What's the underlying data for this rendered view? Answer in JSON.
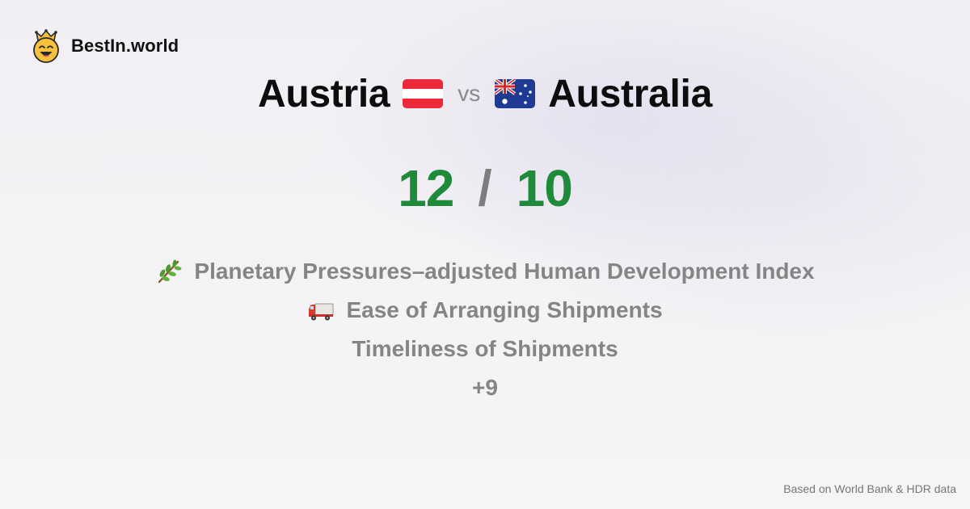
{
  "brand": {
    "name": "BestIn.world",
    "logo_icon": "crowned-smiley-icon"
  },
  "comparison": {
    "left": {
      "name": "Austria",
      "flag_icon": "austria-flag-icon",
      "score": "12"
    },
    "vs_label": "vs",
    "right": {
      "name": "Australia",
      "flag_icon": "australia-flag-icon",
      "score": "10"
    },
    "score_separator": "/"
  },
  "metrics": [
    {
      "label": "Planetary Pressures–adjusted Human Development Index",
      "icon": "herb-icon"
    },
    {
      "label": "Ease of Arranging Shipments",
      "icon": "delivery-truck-icon"
    },
    {
      "label": "Timeliness of Shipments",
      "icon": ""
    }
  ],
  "more_label": "+9",
  "footer": {
    "source": "Based on World Bank & HDR data"
  },
  "colors": {
    "score_green": "#1f8a3a",
    "muted_gray": "#858585",
    "title_black": "#0d0d0d",
    "logo_yellow": "#f6c13c"
  }
}
